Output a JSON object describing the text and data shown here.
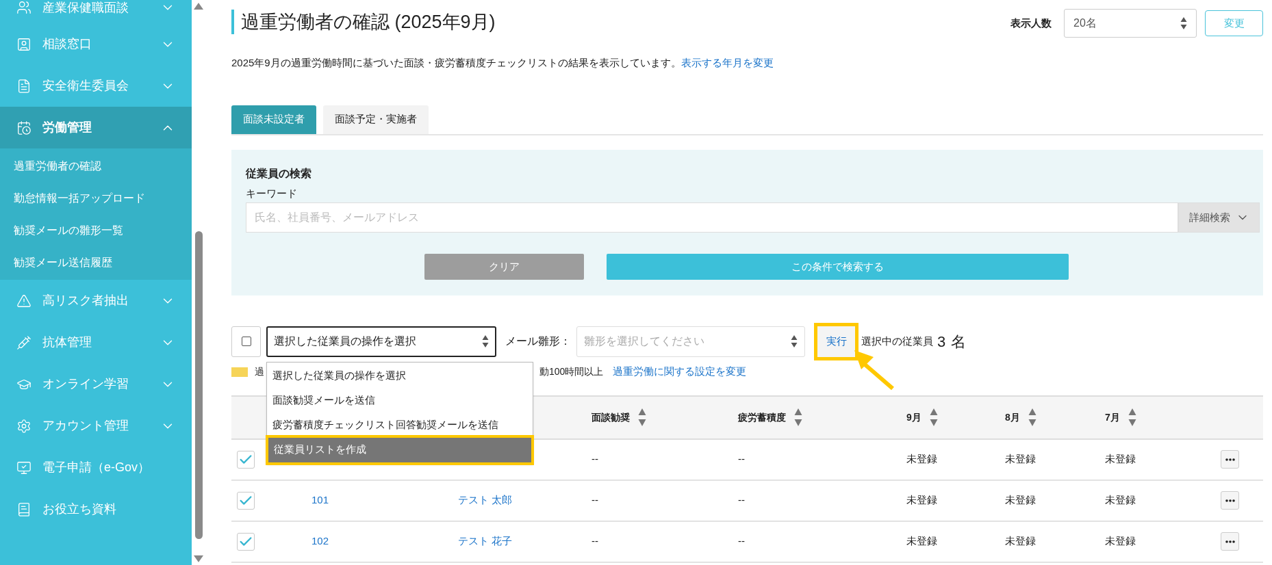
{
  "sidebar": {
    "items": [
      {
        "label": "産業保健職面談",
        "kind": "group",
        "expanded": false,
        "selected": false
      },
      {
        "label": "相談窓口",
        "kind": "group",
        "expanded": false,
        "selected": false
      },
      {
        "label": "安全衛生委員会",
        "kind": "group",
        "expanded": false,
        "selected": false
      },
      {
        "label": "労働管理",
        "kind": "group",
        "expanded": true,
        "selected": true,
        "children": [
          {
            "label": "過重労働者の確認"
          },
          {
            "label": "勤怠情報一括アップロード"
          },
          {
            "label": "勧奨メールの雛形一覧"
          },
          {
            "label": "勧奨メール送信履歴"
          }
        ]
      },
      {
        "label": "高リスク者抽出",
        "kind": "group",
        "expanded": false,
        "selected": false
      },
      {
        "label": "抗体管理",
        "kind": "group",
        "expanded": false,
        "selected": false
      },
      {
        "label": "オンライン学習",
        "kind": "group",
        "expanded": false,
        "selected": false
      },
      {
        "label": "アカウント管理",
        "kind": "group",
        "expanded": false,
        "selected": false
      },
      {
        "label": "電子申請（e-Gov）",
        "kind": "link",
        "selected": false
      },
      {
        "label": "お役立ち資料",
        "kind": "link",
        "selected": false
      }
    ]
  },
  "page": {
    "title": "過重労働者の確認 (2025年9月)",
    "description": "2025年9月の過重労働時間に基づいた面談・疲労蓄積度チェックリストの結果を表示しています。",
    "description_link": "表示する年月を変更"
  },
  "page_size": {
    "label": "表示人数",
    "value": "20名",
    "button": "変更"
  },
  "tabs": [
    {
      "label": "面談未設定者",
      "selected": true
    },
    {
      "label": "面談予定・実施者",
      "selected": false
    }
  ],
  "search": {
    "title": "従業員の検索",
    "keyword_label": "キーワード",
    "placeholder": "氏名、社員番号、メールアドレス",
    "advanced_button": "詳細検索",
    "clear_button": "クリア",
    "submit_button": "この条件で検索する"
  },
  "bulk_actions": {
    "select_all_checked": false,
    "action_select": {
      "value": "選択した従業員の操作を選択",
      "expanded": true,
      "options": [
        {
          "label": "選択した従業員の操作を選択",
          "highlighted": false
        },
        {
          "label": "面談勧奨メールを送信",
          "highlighted": false
        },
        {
          "label": "疲労蓄積度チェックリスト回答勧奨メールを送信",
          "highlighted": false
        },
        {
          "label": "従業員リストを作成",
          "highlighted": true
        }
      ]
    },
    "template_label": "メール雛形：",
    "template_placeholder": "雛形を選択してください",
    "run_button": "実行",
    "selected_label": "選択中の従業員",
    "selected_count": "3",
    "selected_unit": "名"
  },
  "legend": {
    "text_start": "過",
    "text_end": "動100時間以上",
    "link": "過重労働に関する設定を変更"
  },
  "table": {
    "columns": [
      {
        "label": "面談勧奨"
      },
      {
        "label": "疲労蓄積度"
      },
      {
        "label": "9月"
      },
      {
        "label": "8月"
      },
      {
        "label": "7月"
      }
    ],
    "rows": [
      {
        "checked": true,
        "interview": "--",
        "fatigue": "--",
        "months": [
          "未登録",
          "未登録",
          "未登録"
        ]
      },
      {
        "checked": true,
        "id": "101",
        "name": "テスト 太郎",
        "interview": "--",
        "fatigue": "--",
        "months": [
          "未登録",
          "未登録",
          "未登録"
        ]
      },
      {
        "checked": true,
        "id": "102",
        "name": "テスト 花子",
        "interview": "--",
        "fatigue": "--",
        "months": [
          "未登録",
          "未登録",
          "未登録"
        ]
      }
    ]
  }
}
